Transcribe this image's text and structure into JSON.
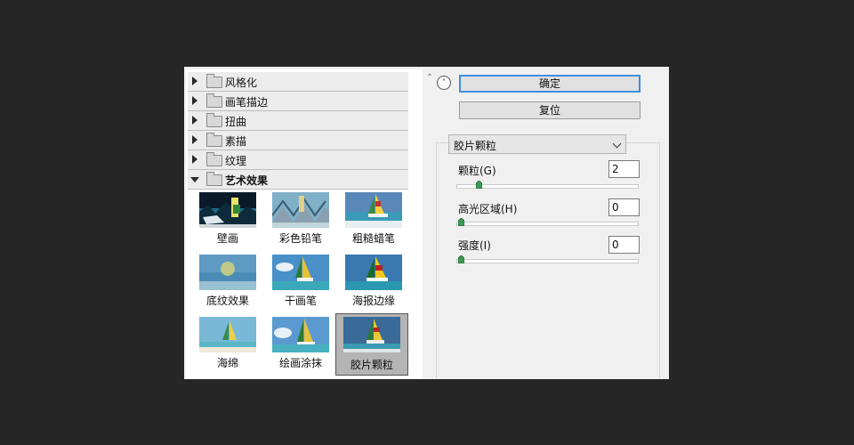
{
  "filter_gallery": {
    "categories": [
      {
        "label": "风格化"
      },
      {
        "label": "画笔描边"
      },
      {
        "label": "扭曲"
      },
      {
        "label": "素描"
      },
      {
        "label": "纹理"
      },
      {
        "label": "艺术效果"
      }
    ],
    "thumbnails": [
      {
        "label": "壁画"
      },
      {
        "label": "彩色铅笔"
      },
      {
        "label": "粗糙蜡笔"
      },
      {
        "label": "底纹效果"
      },
      {
        "label": "干画笔"
      },
      {
        "label": "海报边缘"
      },
      {
        "label": "海绵"
      },
      {
        "label": "绘画涂抹"
      },
      {
        "label": "胶片颗粒"
      }
    ],
    "selected_thumbnail": "胶片颗粒"
  },
  "buttons": {
    "ok_label": "确定",
    "reset_label": "复位"
  },
  "filter_select": {
    "value": "胶片颗粒"
  },
  "params": [
    {
      "label": "颗粒(G)",
      "value": "2",
      "fraction": 0.1
    },
    {
      "label": "高光区域(H)",
      "value": "0",
      "fraction": 0.0
    },
    {
      "label": "强度(I)",
      "value": "0",
      "fraction": 0.0
    }
  ],
  "colors": {
    "accent": "#3d8ee0",
    "slider_knob": "#3a9a55",
    "background": "#262626",
    "panel": "#f0f0f0"
  },
  "icons": [
    "expand-triangle-icon",
    "collapse-triangle-icon",
    "folder-icon",
    "chevron-down-icon",
    "collapse-panel-icon",
    "scroll-up-icon"
  ]
}
